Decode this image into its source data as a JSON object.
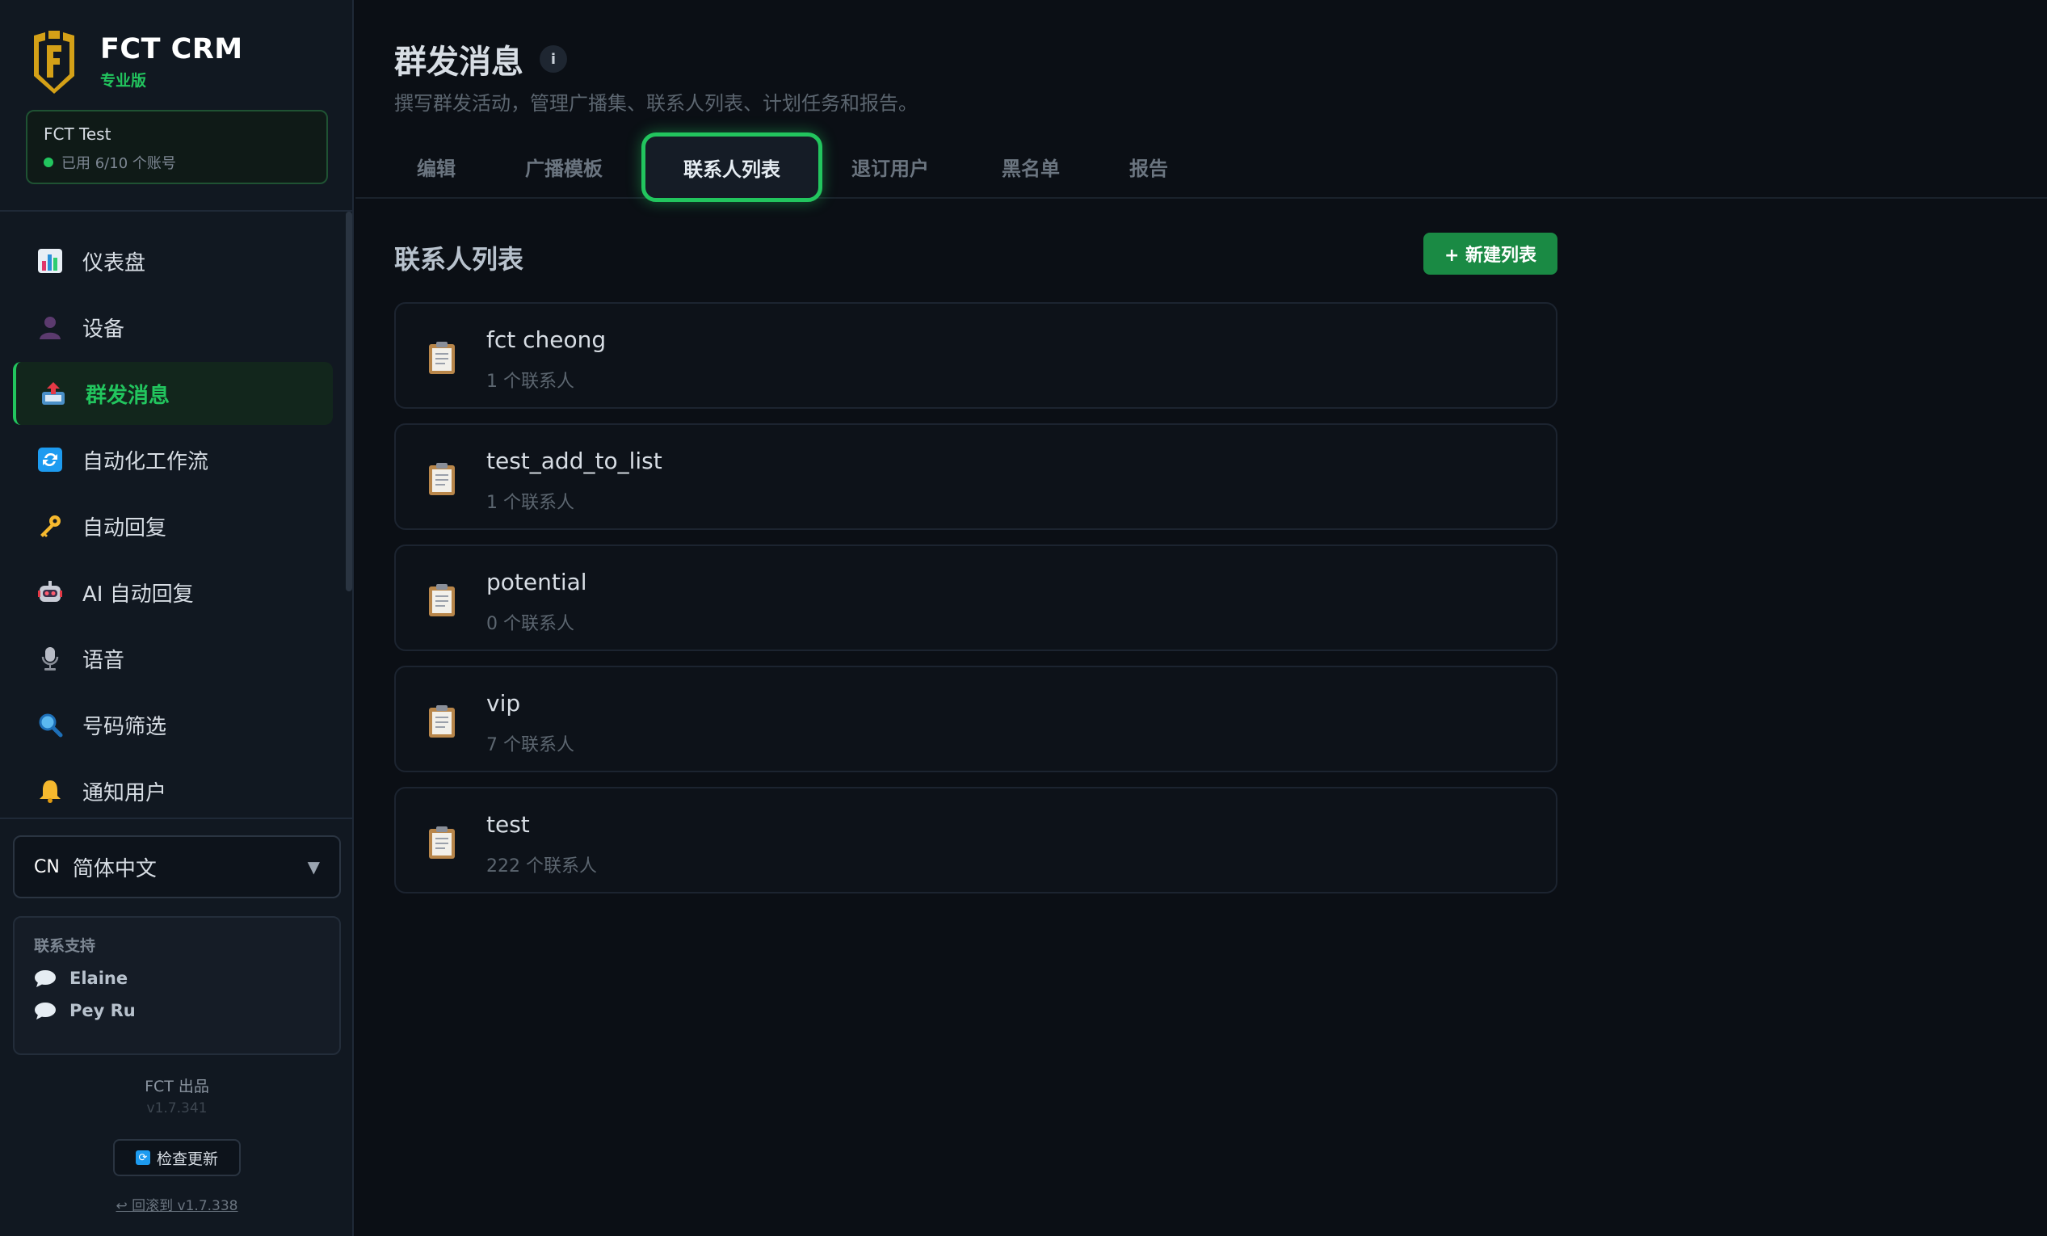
{
  "brand": {
    "name": "FCT CRM",
    "edition": "专业版"
  },
  "account": {
    "name": "FCT Test",
    "usage": "已用 6/10 个账号"
  },
  "nav": {
    "items": [
      {
        "label": "仪表盘",
        "icon": "bar-chart-icon"
      },
      {
        "label": "设备",
        "icon": "user-silhouette-icon"
      },
      {
        "label": "群发消息",
        "icon": "outbox-tray-icon",
        "active": true
      },
      {
        "label": "自动化工作流",
        "icon": "refresh-icon"
      },
      {
        "label": "自动回复",
        "icon": "key-icon"
      },
      {
        "label": "AI 自动回复",
        "icon": "robot-icon"
      },
      {
        "label": "语音",
        "icon": "microphone-icon"
      },
      {
        "label": "号码筛选",
        "icon": "magnifier-icon"
      },
      {
        "label": "通知用户",
        "icon": "bell-icon"
      }
    ]
  },
  "language": {
    "code": "CN",
    "label": "简体中文"
  },
  "support": {
    "title": "联系支持",
    "contacts": [
      "Elaine",
      "Pey Ru"
    ]
  },
  "footer": {
    "maker": "FCT 出品",
    "version": "v1.7.341",
    "update_label": "检查更新",
    "rollback_label": "↩ 回滚到 v1.7.338"
  },
  "page": {
    "title": "群发消息",
    "subtitle": "撰写群发活动，管理广播集、联系人列表、计划任务和报告。"
  },
  "tabs": [
    {
      "label": "编辑"
    },
    {
      "label": "广播模板"
    },
    {
      "label": "联系人列表",
      "active": true
    },
    {
      "label": "退订用户"
    },
    {
      "label": "黑名单"
    },
    {
      "label": "报告"
    }
  ],
  "section": {
    "title": "联系人列表",
    "new_button": "+ 新建列表"
  },
  "lists": [
    {
      "name": "fct cheong",
      "count": "1 个联系人"
    },
    {
      "name": "test_add_to_list",
      "count": "1 个联系人"
    },
    {
      "name": "potential",
      "count": "0 个联系人"
    },
    {
      "name": "vip",
      "count": "7 个联系人"
    },
    {
      "name": "test",
      "count": "222 个联系人"
    }
  ],
  "colors": {
    "accent": "#22c55e",
    "background": "#0b0f15",
    "sidebar": "#111821",
    "button": "#1a8a44"
  }
}
